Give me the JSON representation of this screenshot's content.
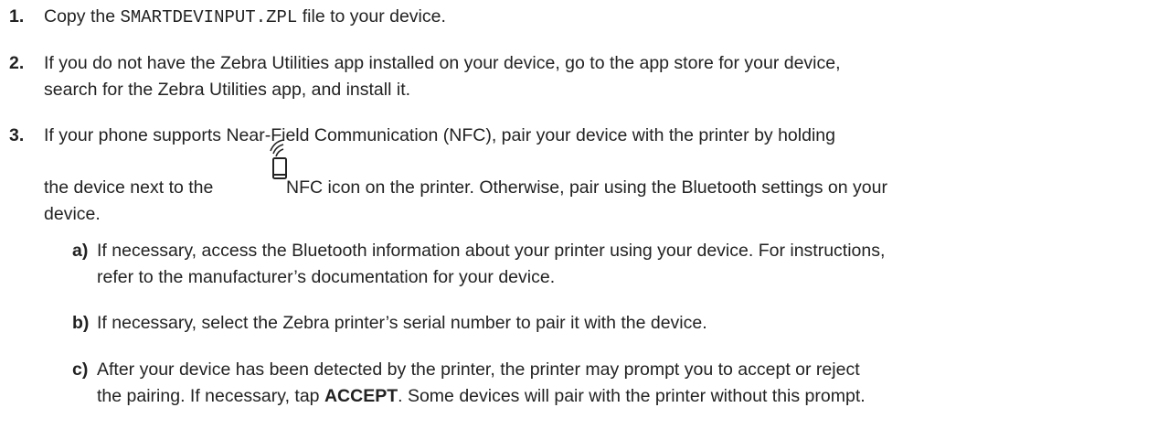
{
  "steps": [
    {
      "number": "1.",
      "before": "Copy the ",
      "filename": "SMARTDEVINPUT.ZPL",
      "after": " file to your device."
    },
    {
      "number": "2.",
      "line1": "If you do not have the Zebra Utilities app installed on your device, go to the app store for your device,",
      "line2": "search for the Zebra Utilities app, and install it."
    },
    {
      "number": "3.",
      "line1": "If your phone supports Near-Field Communication (NFC), pair your device with the printer by holding",
      "line2_before": "the device next to the",
      "icon": "nfc-icon",
      "line2_after": "NFC icon on the printer. Otherwise, pair using the Bluetooth settings on your",
      "line3": "device."
    }
  ],
  "substeps": [
    {
      "label": "a)",
      "line1": "If necessary, access the Bluetooth information about your printer using your device. For instructions,",
      "line2": "refer to the manufacturer’s documentation for your device."
    },
    {
      "label": "b)",
      "line1": "If necessary, select the Zebra printer’s serial number to pair it with the device."
    },
    {
      "label": "c)",
      "line1": "After your device has been detected by the printer, the printer may prompt you to accept or reject",
      "line2_before": "the pairing. If necessary, tap ",
      "accept": "ACCEPT",
      "line2_after": ". Some devices will pair with the printer without this prompt."
    }
  ]
}
